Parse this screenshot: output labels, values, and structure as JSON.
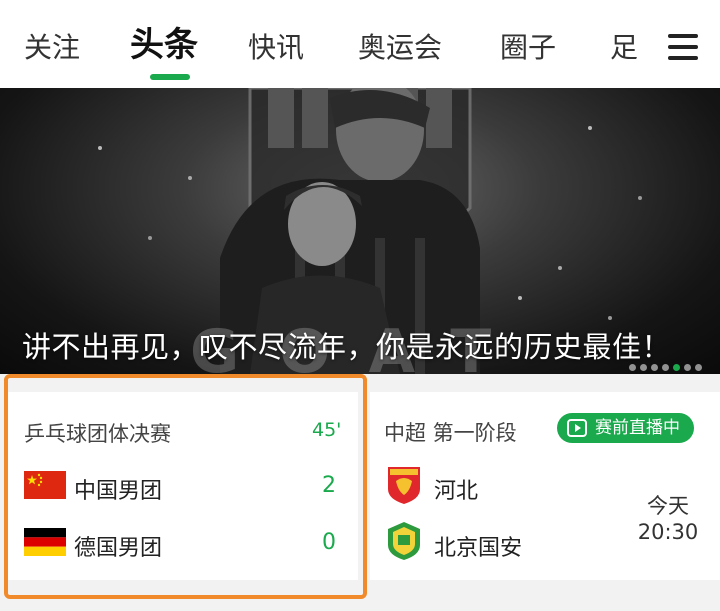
{
  "tabs": [
    {
      "label": "关注"
    },
    {
      "label": "头条",
      "active": true
    },
    {
      "label": "快讯"
    },
    {
      "label": "奥运会"
    },
    {
      "label": "圈子"
    },
    {
      "label": "足"
    }
  ],
  "menu_icon": "hamburger-menu-icon",
  "hero": {
    "caption": "讲不出再见，叹不尽流年，你是永远的历史最佳！",
    "watermark_text": "GOAT",
    "carousel_dots": 7,
    "active_dot_index": 4
  },
  "match_left": {
    "competition": "乒乓球团体决赛",
    "minute": "45'",
    "team1": {
      "name": "中国男团",
      "score": "2",
      "flag": "china-flag-icon"
    },
    "team2": {
      "name": "德国男团",
      "score": "0",
      "flag": "germany-flag-icon"
    }
  },
  "match_right": {
    "competition": "中超 第一阶段",
    "status_badge": "赛前直播中",
    "team1": {
      "name": "河北",
      "logo": "hebei-club-logo"
    },
    "team2": {
      "name": "北京国安",
      "logo": "beijing-guoan-logo"
    },
    "day": "今天",
    "time": "20:30"
  },
  "colors": {
    "accent_green": "#1aa94c",
    "highlight_orange": "#f08a2a"
  }
}
